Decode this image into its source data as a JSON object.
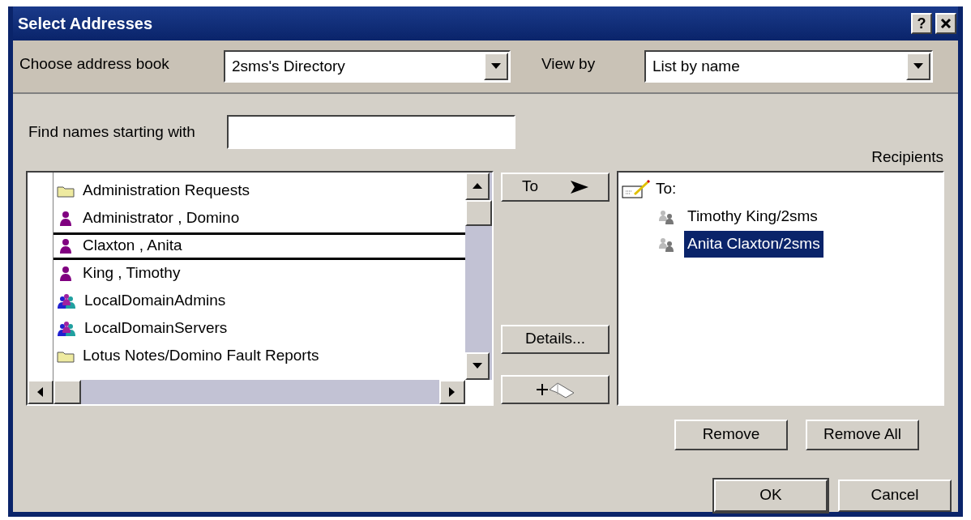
{
  "window": {
    "title": "Select Addresses",
    "help": "?"
  },
  "address_book": {
    "label": "Choose address book",
    "value": "2sms's Directory"
  },
  "view_by": {
    "label": "View by",
    "value": "List by name"
  },
  "find": {
    "label": "Find names starting with"
  },
  "entries": [
    {
      "name": "Administration Requests",
      "kind": "folder",
      "selected": false
    },
    {
      "name": "Administrator , Domino",
      "kind": "person",
      "selected": false
    },
    {
      "name": "Claxton , Anita",
      "kind": "person",
      "selected": true
    },
    {
      "name": "King , Timothy",
      "kind": "person",
      "selected": false
    },
    {
      "name": "LocalDomainAdmins",
      "kind": "group",
      "selected": false
    },
    {
      "name": "LocalDomainServers",
      "kind": "group",
      "selected": false
    },
    {
      "name": "Lotus Notes/Domino Fault Reports",
      "kind": "folder",
      "selected": false
    }
  ],
  "side_buttons": [
    {
      "kind": "to",
      "label": "To"
    },
    {
      "kind": "details",
      "label": "Details..."
    },
    {
      "kind": "add-book"
    }
  ],
  "recipients": {
    "label": "Recipients",
    "groups": [
      {
        "label": "To:",
        "children": [
          {
            "name": "Timothy King/2sms",
            "selected": false
          },
          {
            "name": "Anita Claxton/2sms",
            "selected": true
          }
        ]
      }
    ]
  },
  "action_buttons": [
    "Remove",
    "Remove All"
  ],
  "dialog_buttons": [
    {
      "label": "OK",
      "default": true
    },
    {
      "label": "Cancel",
      "default": false
    }
  ]
}
